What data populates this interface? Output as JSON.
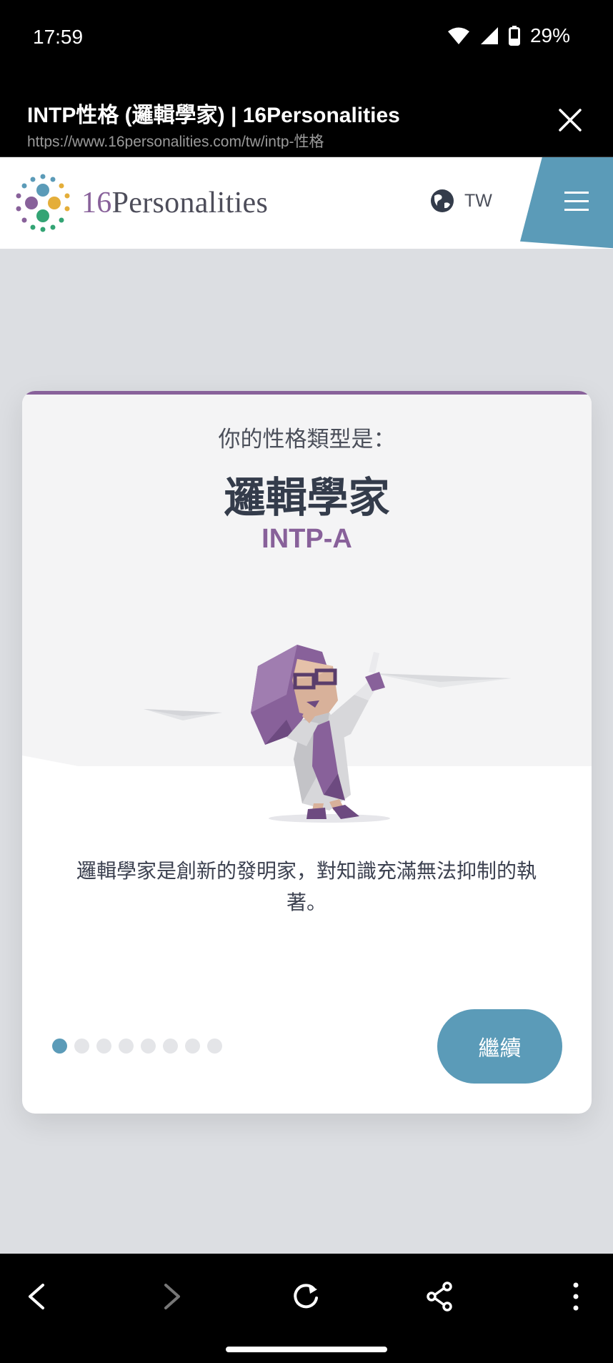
{
  "status_bar": {
    "time": "17:59",
    "battery": "29%",
    "icons": [
      "wifi-icon",
      "signal-icon",
      "battery-icon"
    ]
  },
  "browser": {
    "title": "INTP性格 (邏輯學家) | 16Personalities",
    "url": "https://www.16personalities.com/tw/intp-性格",
    "close_icon": "close-icon"
  },
  "header": {
    "logo_number": "16",
    "logo_word": "Personalities",
    "language": "TW",
    "globe_icon": "globe-icon",
    "menu_icon": "hamburger-menu-icon",
    "menu_color": "#5b9bb8"
  },
  "card": {
    "subtitle": "你的性格類型是：",
    "type_name": "邏輯學家",
    "type_code": "INTP-A",
    "description": "邏輯學家是創新的發明家，對知識充滿無法抑制的執著。",
    "accent_color": "#88619a",
    "progress": {
      "total": 8,
      "current": 1
    },
    "continue_label": "繼續"
  },
  "nav": {
    "icons": [
      "back-icon",
      "forward-icon",
      "reload-icon",
      "share-icon",
      "more-icon"
    ]
  }
}
